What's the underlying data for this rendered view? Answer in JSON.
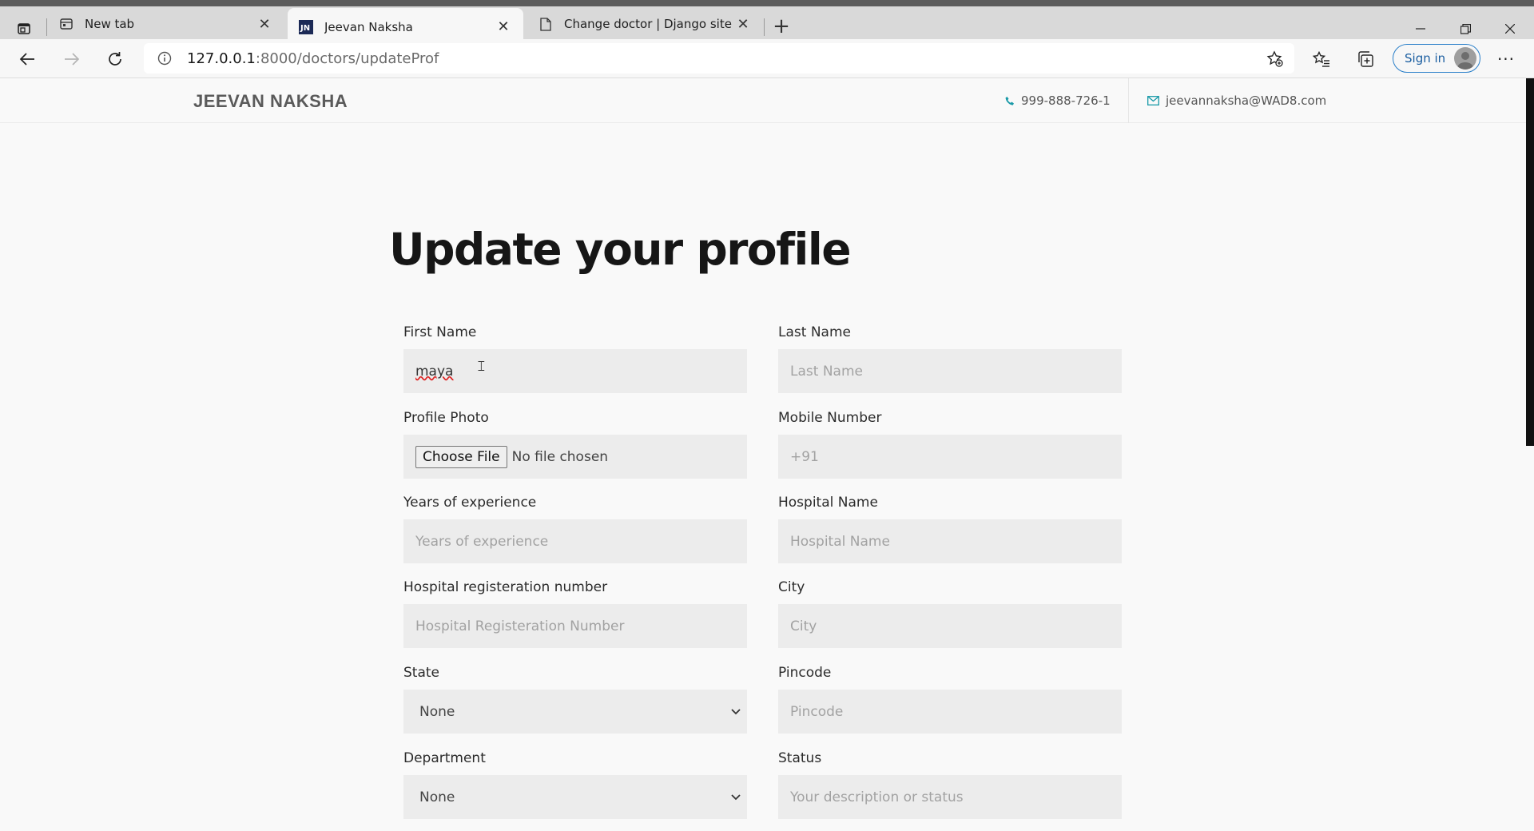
{
  "browser": {
    "tabs": [
      {
        "title": "New tab",
        "icon": "newtab-page-icon",
        "active": false
      },
      {
        "title": "Jeevan Naksha",
        "icon": "jn-favicon",
        "active": true
      },
      {
        "title": "Change doctor | Django site adm",
        "icon": "document-icon",
        "active": false
      }
    ],
    "new_tab_symbol": "+",
    "url_host": "127.0.0.1",
    "url_path": ":8000/doctors/updateProf",
    "sign_in_label": "Sign in",
    "more_symbol": "···"
  },
  "site": {
    "brand": "JEEVAN NAKSHA",
    "phone": "999-888-726-1",
    "email": "jeevannaksha@WAD8.com",
    "accent_color": "#1a9aa8"
  },
  "form": {
    "title": "Update your profile",
    "first_name": {
      "label": "First Name",
      "value": "maya"
    },
    "last_name": {
      "label": "Last Name",
      "placeholder": "Last Name"
    },
    "profile_photo": {
      "label": "Profile Photo",
      "button": "Choose File",
      "status": "No file chosen"
    },
    "mobile": {
      "label": "Mobile Number",
      "placeholder": "+91"
    },
    "experience": {
      "label": "Years of experience",
      "placeholder": "Years of experience"
    },
    "hospital_name": {
      "label": "Hospital Name",
      "placeholder": "Hospital Name"
    },
    "hospital_reg": {
      "label": "Hospital registeration number",
      "placeholder": "Hospital Registeration Number"
    },
    "city": {
      "label": "City",
      "placeholder": "City"
    },
    "state": {
      "label": "State",
      "selected": "None"
    },
    "pincode": {
      "label": "Pincode",
      "placeholder": "Pincode"
    },
    "department": {
      "label": "Department",
      "selected": "None"
    },
    "status": {
      "label": "Status",
      "placeholder": "Your description or status"
    }
  }
}
